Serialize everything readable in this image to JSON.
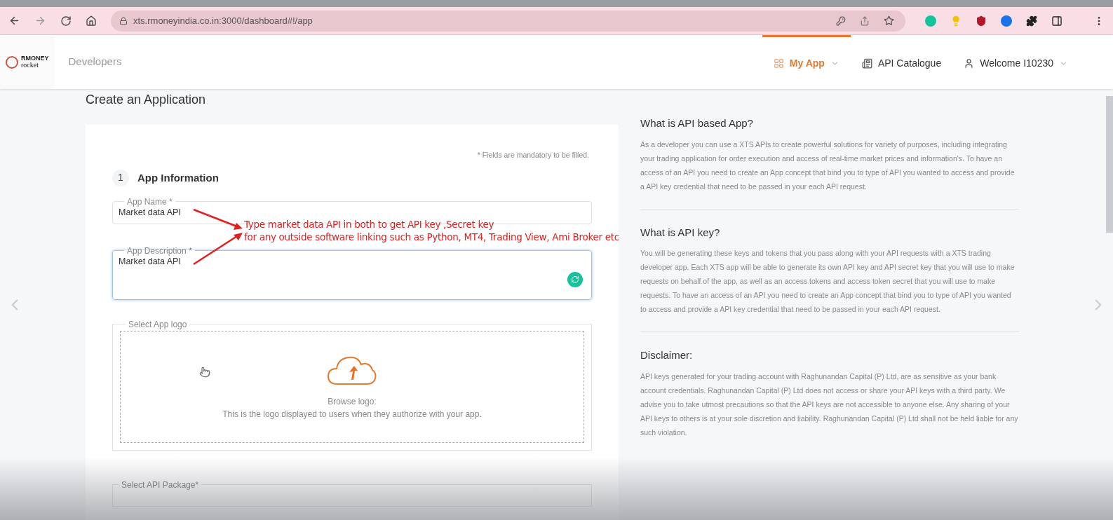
{
  "browser": {
    "url": "xts.rmoneyindia.co.in:3000/dashboard#!/app"
  },
  "header": {
    "brand": "RMONEY",
    "brand_sub": "rocket",
    "section": "Developers",
    "nav": [
      {
        "kind": "apps",
        "label": "My App",
        "selected": true,
        "has_menu": true
      },
      {
        "kind": "catalogue",
        "label": "API Catalogue",
        "selected": false,
        "has_menu": false
      },
      {
        "kind": "user",
        "label": "Welcome I10230",
        "selected": false,
        "has_menu": true
      }
    ]
  },
  "page_title": "Create an Application",
  "form": {
    "note": "* Fields are mandatory to be filled.",
    "step": {
      "number": "1",
      "title": "App Information"
    },
    "fields": [
      {
        "kind": "input",
        "label": "App Name *",
        "value": "Market data API",
        "focused": false
      },
      {
        "kind": "textarea",
        "label": "App Description *",
        "value": "Market data API",
        "focused": true
      }
    ],
    "logo": {
      "label": "Select App logo",
      "title": "Browse logo:",
      "caption": "This is the logo displayed to users when they authorize with your app."
    },
    "package": {
      "label": "Select API Package*"
    }
  },
  "annotation": {
    "lines": [
      "Type market data API in both to get API key ,Secret key",
      "for any outside software linking such as Python, MT4, Trading View, Ami Broker etc"
    ]
  },
  "info": [
    {
      "title": "What is API based App?",
      "body": "As a developer you can use a XTS APIs to create powerful solutions for variety of purposes, including integrating your trading application for order execution and access of real-time market prices and information's. To have an access of an API you need to create an App concept that bind you to type of API you wanted to access and provide a API key credential that need to be passed in your each API request."
    },
    {
      "title": "What is API key?",
      "body": "You will be generating these keys and tokens that you pass along with your API requests with a XTS trading developer app. Each XTS app will be able to generate its own API key and API secret key that you will use to make requests on behalf of the app, as well as an access tokens and access token secret that you will use to make requests. To have an access of an API you need to create an App concept that bind you to type of API you wanted to access and provide a API key credential that need to be passed in your each API request."
    },
    {
      "title": "Disclaimer:",
      "body": "API keys generated for your trading account with Raghunandan Capital (P) Ltd, are as sensitive as your bank account credentials. Raghunandan Capital (P) Ltd does not access or share your API keys with a third party. We advise you to take utmost precautions so that the API keys are not accessible to anyone else. Any sharing of your API keys to others is at your sole discretion and liability. Raghunandan Capital (P) Ltd shall not be held liable for any such violation."
    }
  ]
}
